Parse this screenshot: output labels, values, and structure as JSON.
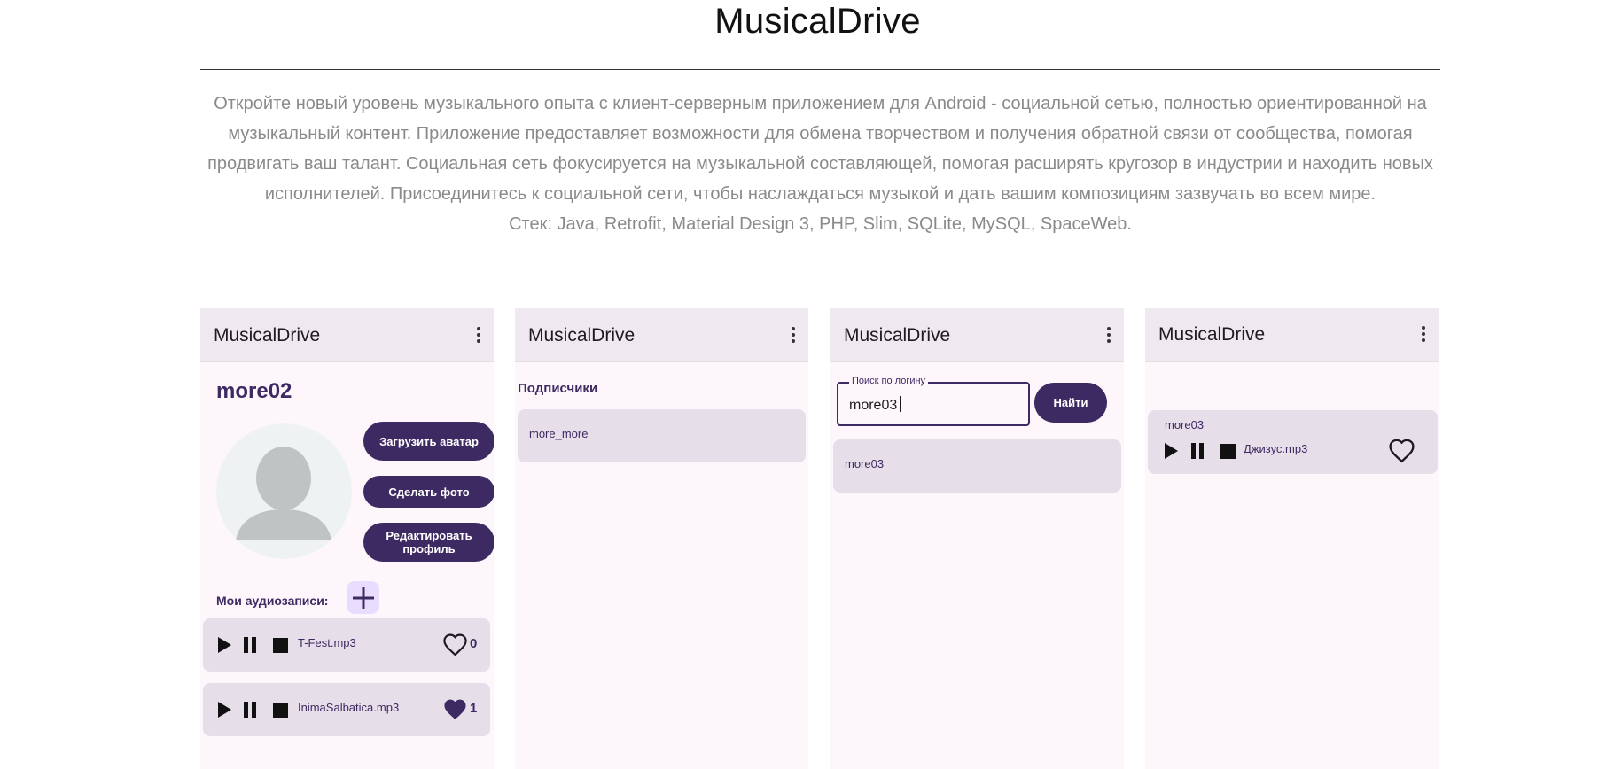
{
  "page": {
    "title": "MusicalDrive",
    "description": "Откройте новый уровень музыкального опыта с клиент-серверным приложением для Android - социальной сетью, полностью ориентированной на музыкальный контент. Приложение предоставляет возможности для обмена творчеством и получения обратной связи от сообщества, помогая продвигать ваш талант. Социальная сеть фокусируется на музыкальной составляющей, помогая расширять кругозор в индустрии и находить новых исполнителей. Присоединитесь к социальной сети, чтобы наслаждаться музыкой и дать вашим композициям зазвучать во всем мире.",
    "stack": "Стек: Java, Retrofit, Material Design 3, PHP, Slim, SQLite, MySQL, SpaceWeb."
  },
  "app_name": "MusicalDrive",
  "profile": {
    "username": "more02",
    "upload_avatar": "Загрузить аватар",
    "take_photo": "Сделать фото",
    "edit_profile": "Редактировать профиль",
    "my_audio_label": "Мои аудиозаписи:",
    "tracks": [
      {
        "name": "T-Fest.mp3",
        "likes": "0",
        "liked": false
      },
      {
        "name": "InimaSalbatica.mp3",
        "likes": "1",
        "liked": true
      }
    ]
  },
  "subscribers": {
    "title": "Подписчики",
    "items": [
      "more_more"
    ]
  },
  "search": {
    "label": "Поиск по логину",
    "value": "more03",
    "button": "Найти",
    "results": [
      "more03"
    ]
  },
  "feed": {
    "items": [
      {
        "author": "more03",
        "track": "Джизус.mp3"
      }
    ]
  },
  "colors": {
    "primary": "#3e2a63",
    "appbar": "#efe8f1",
    "card": "#e6dfea",
    "surface": "#fdf7fc",
    "add_button_bg": "#e9ddff"
  },
  "icons": [
    "more-vert-icon",
    "person-icon",
    "add-icon",
    "play-icon",
    "pause-icon",
    "stop-icon",
    "heart-outline-icon",
    "heart-filled-icon"
  ]
}
